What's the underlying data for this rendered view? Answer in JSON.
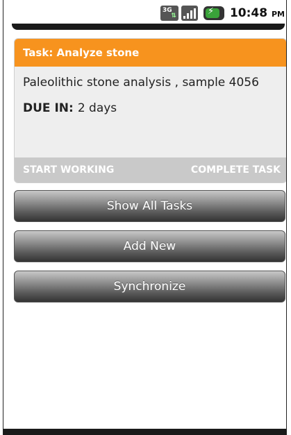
{
  "status_bar": {
    "network_type": "3G",
    "time": "10:48",
    "ampm": "PM"
  },
  "task_card": {
    "title": "Task: Analyze stone",
    "description": "Paleolithic stone analysis , sample 4056",
    "due_label": "DUE IN:",
    "due_value": "2 days",
    "start_label": "START WORKING",
    "complete_label": "COMPLETE TASK",
    "header_color": "#f7931e"
  },
  "buttons": {
    "show_all": "Show All Tasks",
    "add_new": "Add New",
    "synchronize": "Synchronize"
  }
}
